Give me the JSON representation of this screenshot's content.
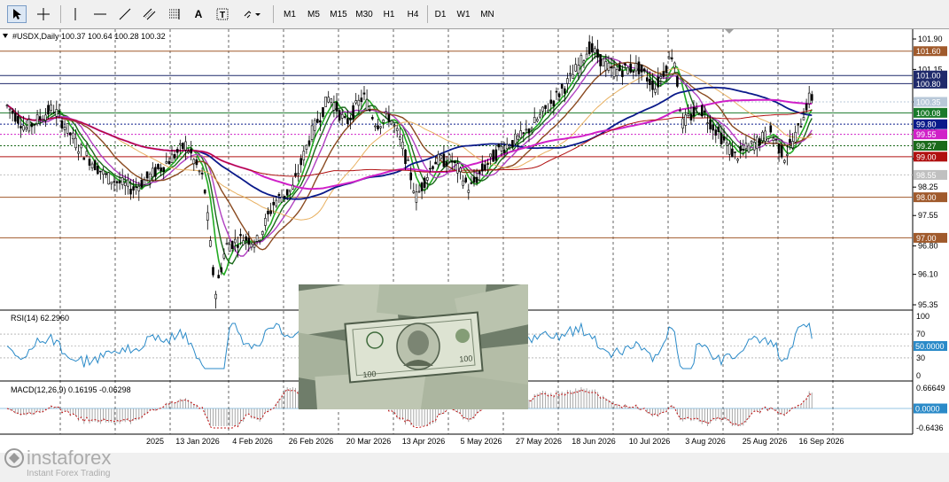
{
  "toolbar": {
    "timeframes": [
      "M1",
      "M5",
      "M15",
      "M30",
      "H1",
      "H4",
      "D1",
      "W1",
      "MN"
    ],
    "tools": [
      "cursor-icon",
      "crosshair-icon",
      "vertical-line-icon",
      "horizontal-line-icon",
      "trendline-icon",
      "channel-icon",
      "fibonacci-icon",
      "text-icon",
      "text-label-icon",
      "arrows-icon"
    ],
    "text_tool": "A",
    "text_label_tool": "T"
  },
  "chart": {
    "header": "#USDX,Daily  100.37 100.64 100.28 100.32",
    "price_axis": [
      "101.90",
      "101.15",
      "100.35",
      "99.65",
      "98.95",
      "98.25",
      "97.55",
      "96.80",
      "96.10",
      "95.35"
    ],
    "level_tags": [
      {
        "text": "101.60",
        "bg": "#a05a2c",
        "fg": "#ffffff"
      },
      {
        "text": "101.00",
        "bg": "#1f2a6b",
        "fg": "#ffffff"
      },
      {
        "text": "100.80",
        "bg": "#1f2a6b",
        "fg": "#ffffff"
      },
      {
        "text": "100.35",
        "bg": "#b8c8d8",
        "fg": "#ffffff"
      },
      {
        "text": "100.08",
        "bg": "#1a7a2a",
        "fg": "#ffffff"
      },
      {
        "text": "99.80",
        "bg": "#0a1a8a",
        "fg": "#ffffff"
      },
      {
        "text": "99.55",
        "bg": "#d020c8",
        "fg": "#ffffff"
      },
      {
        "text": "99.27",
        "bg": "#1a6a1a",
        "fg": "#ffffff"
      },
      {
        "text": "99.00",
        "bg": "#b01010",
        "fg": "#ffffff"
      },
      {
        "text": "98.55",
        "bg": "#c0c0c0",
        "fg": "#ffffff"
      },
      {
        "text": "98.00",
        "bg": "#a05a2c",
        "fg": "#ffffff"
      },
      {
        "text": "97.00",
        "bg": "#a05a2c",
        "fg": "#ffffff"
      }
    ],
    "dates": [
      "2025",
      "13 Jan 2026",
      "4 Feb 2026",
      "26 Feb 2026",
      "20 Mar 2026",
      "13 Apr 2026",
      "5 May 2026",
      "27 May 2026",
      "18 Jun 2026",
      "10 Jul 2026",
      "3 Aug 2026",
      "25 Aug 2026",
      "16 Sep 2026"
    ]
  },
  "rsi": {
    "label": "RSI(14) 62.2960",
    "axis": [
      "100",
      "70",
      "30",
      "0"
    ],
    "tag": "50.0000",
    "current": 62.296
  },
  "macd": {
    "label": "MACD(12,26,9) 0.16195 -0.06298",
    "axis_top": "0.66649",
    "axis_bottom": "-0.6436",
    "tag": "0.0000"
  },
  "brand": {
    "name": "instaforex",
    "tagline": "Instant Forex Trading"
  }
}
